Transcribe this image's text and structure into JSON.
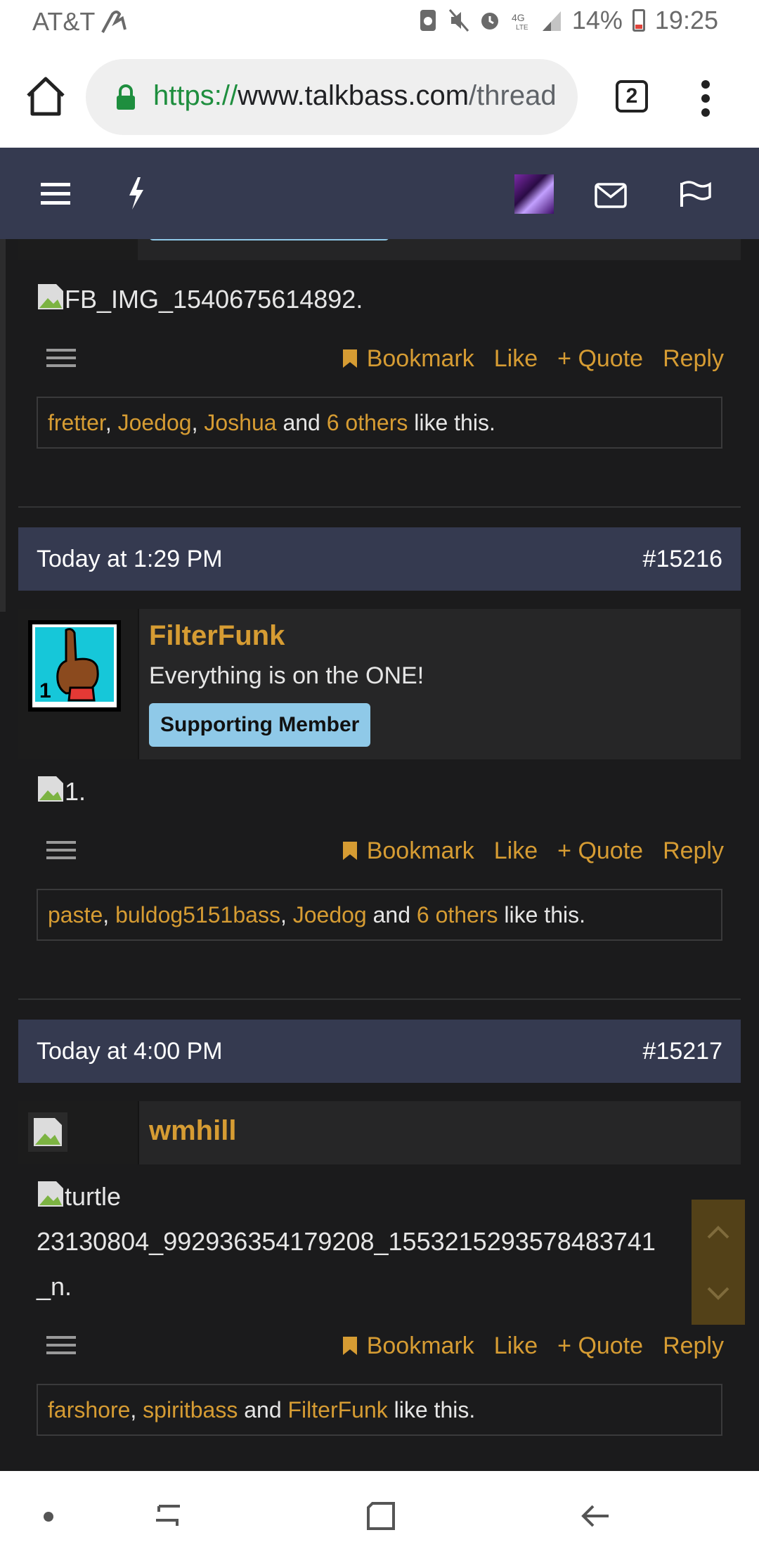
{
  "status_bar": {
    "carrier": "AT&T",
    "battery": "14%",
    "time": "19:25"
  },
  "browser": {
    "url_scheme": "https://",
    "url_host": "www.talkbass.com",
    "url_path": "/thread",
    "tab_count": "2"
  },
  "posts": [
    {
      "image_alt": "FB_IMG_1540675614892.",
      "actions": {
        "bookmark": "Bookmark",
        "like": "Like",
        "quote": "+ Quote",
        "reply": "Reply"
      },
      "likes": {
        "users": [
          "fretter",
          "Joedog",
          "Joshua"
        ],
        "and": "and",
        "others": "6 others",
        "suffix": "like this."
      }
    },
    {
      "date": "Today at 1:29 PM",
      "number": "#15216",
      "username": "FilterFunk",
      "user_title": "Everything is on the ONE!",
      "badge": "Supporting Member",
      "image_alt": "1.",
      "actions": {
        "bookmark": "Bookmark",
        "like": "Like",
        "quote": "+ Quote",
        "reply": "Reply"
      },
      "likes": {
        "users": [
          "paste",
          "buldog5151bass",
          "Joedog"
        ],
        "and": "and",
        "others": "6 others",
        "suffix": "like this."
      }
    },
    {
      "date": "Today at 4:00 PM",
      "number": "#15217",
      "username": "wmhill",
      "image_alt_line1": "turtle",
      "image_alt_line2": "23130804_992936354179208_1553215293578483741",
      "image_alt_line3": "_n.",
      "actions": {
        "bookmark": "Bookmark",
        "like": "Like",
        "quote": "+ Quote",
        "reply": "Reply"
      },
      "likes": {
        "users": [
          "farshore",
          "spiritbass"
        ],
        "and": "and",
        "last_user": "FilterFunk",
        "suffix": "like this."
      }
    }
  ],
  "colors": {
    "accent": "#d69c33",
    "nav_bg": "#353a50",
    "page_bg": "#1b1b1c",
    "badge": "#8fc9e8"
  }
}
